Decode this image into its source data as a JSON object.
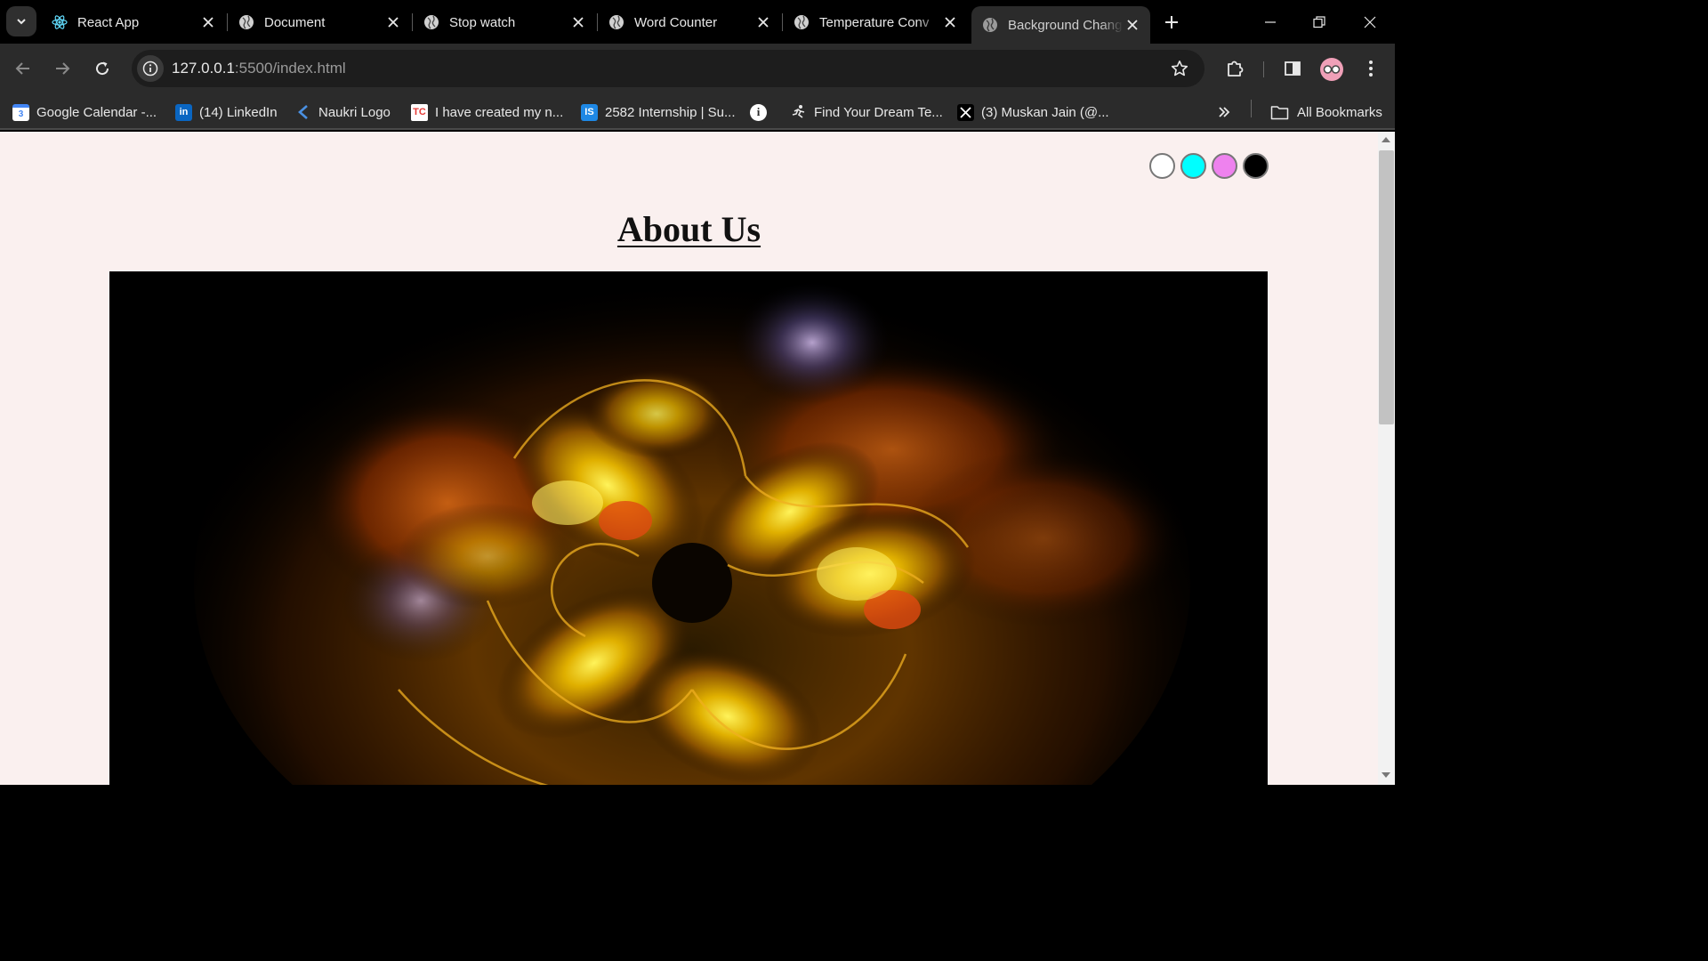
{
  "browser": {
    "tabs": [
      {
        "title": "React App",
        "icon": "react-icon"
      },
      {
        "title": "Document",
        "icon": "globe-icon"
      },
      {
        "title": "Stop watch",
        "icon": "globe-icon"
      },
      {
        "title": "Word Counter",
        "icon": "globe-icon"
      },
      {
        "title": "Temperature Conv",
        "icon": "globe-icon"
      },
      {
        "title": "Background Chang",
        "icon": "globe-icon",
        "active": true
      }
    ],
    "url": {
      "host": "127.0.0.1",
      "path": ":5500/index.html"
    },
    "bookmarks": [
      {
        "label": "Google Calendar -...",
        "icon": "google-calendar-icon"
      },
      {
        "label": "(14) LinkedIn",
        "icon": "linkedin-icon"
      },
      {
        "label": "Naukri Logo",
        "icon": "naukri-icon"
      },
      {
        "label": "I have created my n...",
        "icon": "tc-icon"
      },
      {
        "label": "2582 Internship | Su...",
        "icon": "internshala-icon"
      },
      {
        "label": "",
        "icon": "info-icon"
      },
      {
        "label": "Find Your Dream Te...",
        "icon": "runner-icon"
      },
      {
        "label": "(3) Muskan Jain (@...",
        "icon": "x-icon"
      }
    ],
    "all_bookmarks_label": "All Bookmarks"
  },
  "page": {
    "heading": "About Us",
    "swatches": [
      {
        "name": "white",
        "color": "#ffffff"
      },
      {
        "name": "cyan",
        "color": "#00ffff"
      },
      {
        "name": "violet",
        "color": "#ee82ee"
      },
      {
        "name": "black",
        "color": "#000000"
      }
    ],
    "background_color": "#faf0ef"
  }
}
